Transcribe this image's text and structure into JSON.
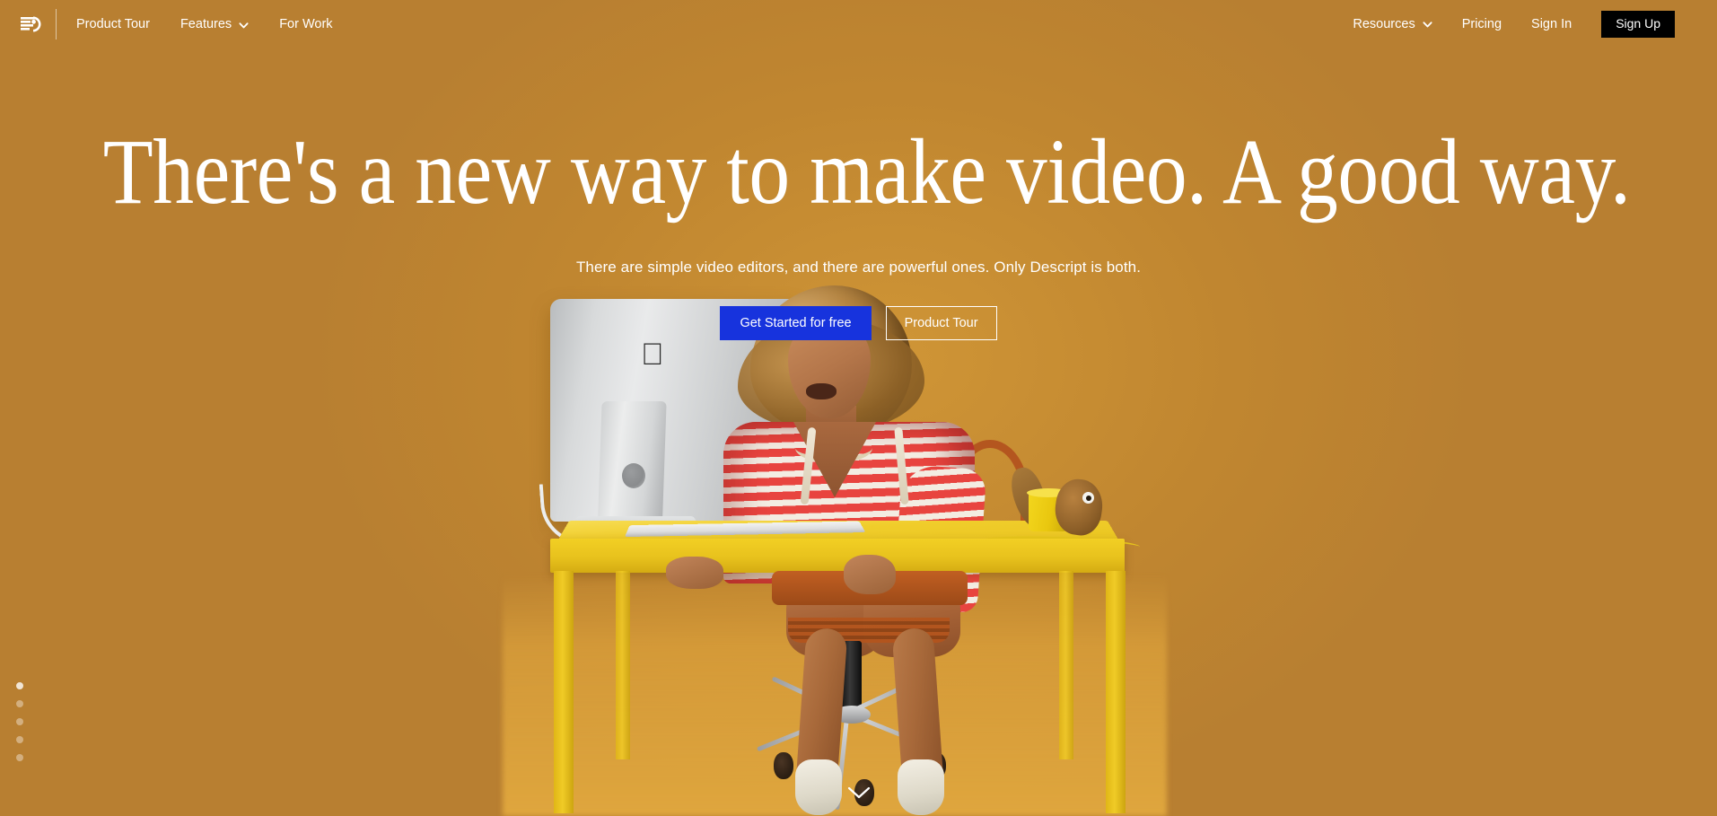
{
  "theme": {
    "background_color": "#b87f31",
    "accent_blue": "#1733dd",
    "signup_bg": "#000000",
    "text_color": "#ffffff",
    "desk_yellow": "#f0cb26",
    "sweater_red": "#e8443f"
  },
  "navbar": {
    "logo": {
      "name": "descript-logo",
      "alt": "Descript"
    },
    "left_items": [
      {
        "label": "Product Tour",
        "has_caret": false
      },
      {
        "label": "Features",
        "has_caret": true
      },
      {
        "label": "For Work",
        "has_caret": false
      }
    ],
    "right_items": [
      {
        "label": "Resources",
        "has_caret": true
      },
      {
        "label": "Pricing",
        "has_caret": false
      },
      {
        "label": "Sign In",
        "has_caret": false
      }
    ],
    "signup_label": "Sign Up"
  },
  "hero": {
    "headline": "There's a new way to make video. A good way.",
    "subhead": "There are simple video editors, and there are powerful ones. Only Descript is both.",
    "primary_cta": "Get Started for free",
    "secondary_cta": "Product Tour"
  },
  "carousel": {
    "total_slides": 5,
    "active_index": 0
  },
  "scroll_hint": {
    "icon": "chevron-down-icon"
  },
  "scene": {
    "description": "Person with curly hair in red and white striped hoodie seated at a yellow desk using an iMac, on an orange studio backdrop",
    "objects": [
      "imac",
      "keyboard",
      "yellow-cup",
      "toy-figurine",
      "office-chair",
      "yellow-desk"
    ]
  }
}
